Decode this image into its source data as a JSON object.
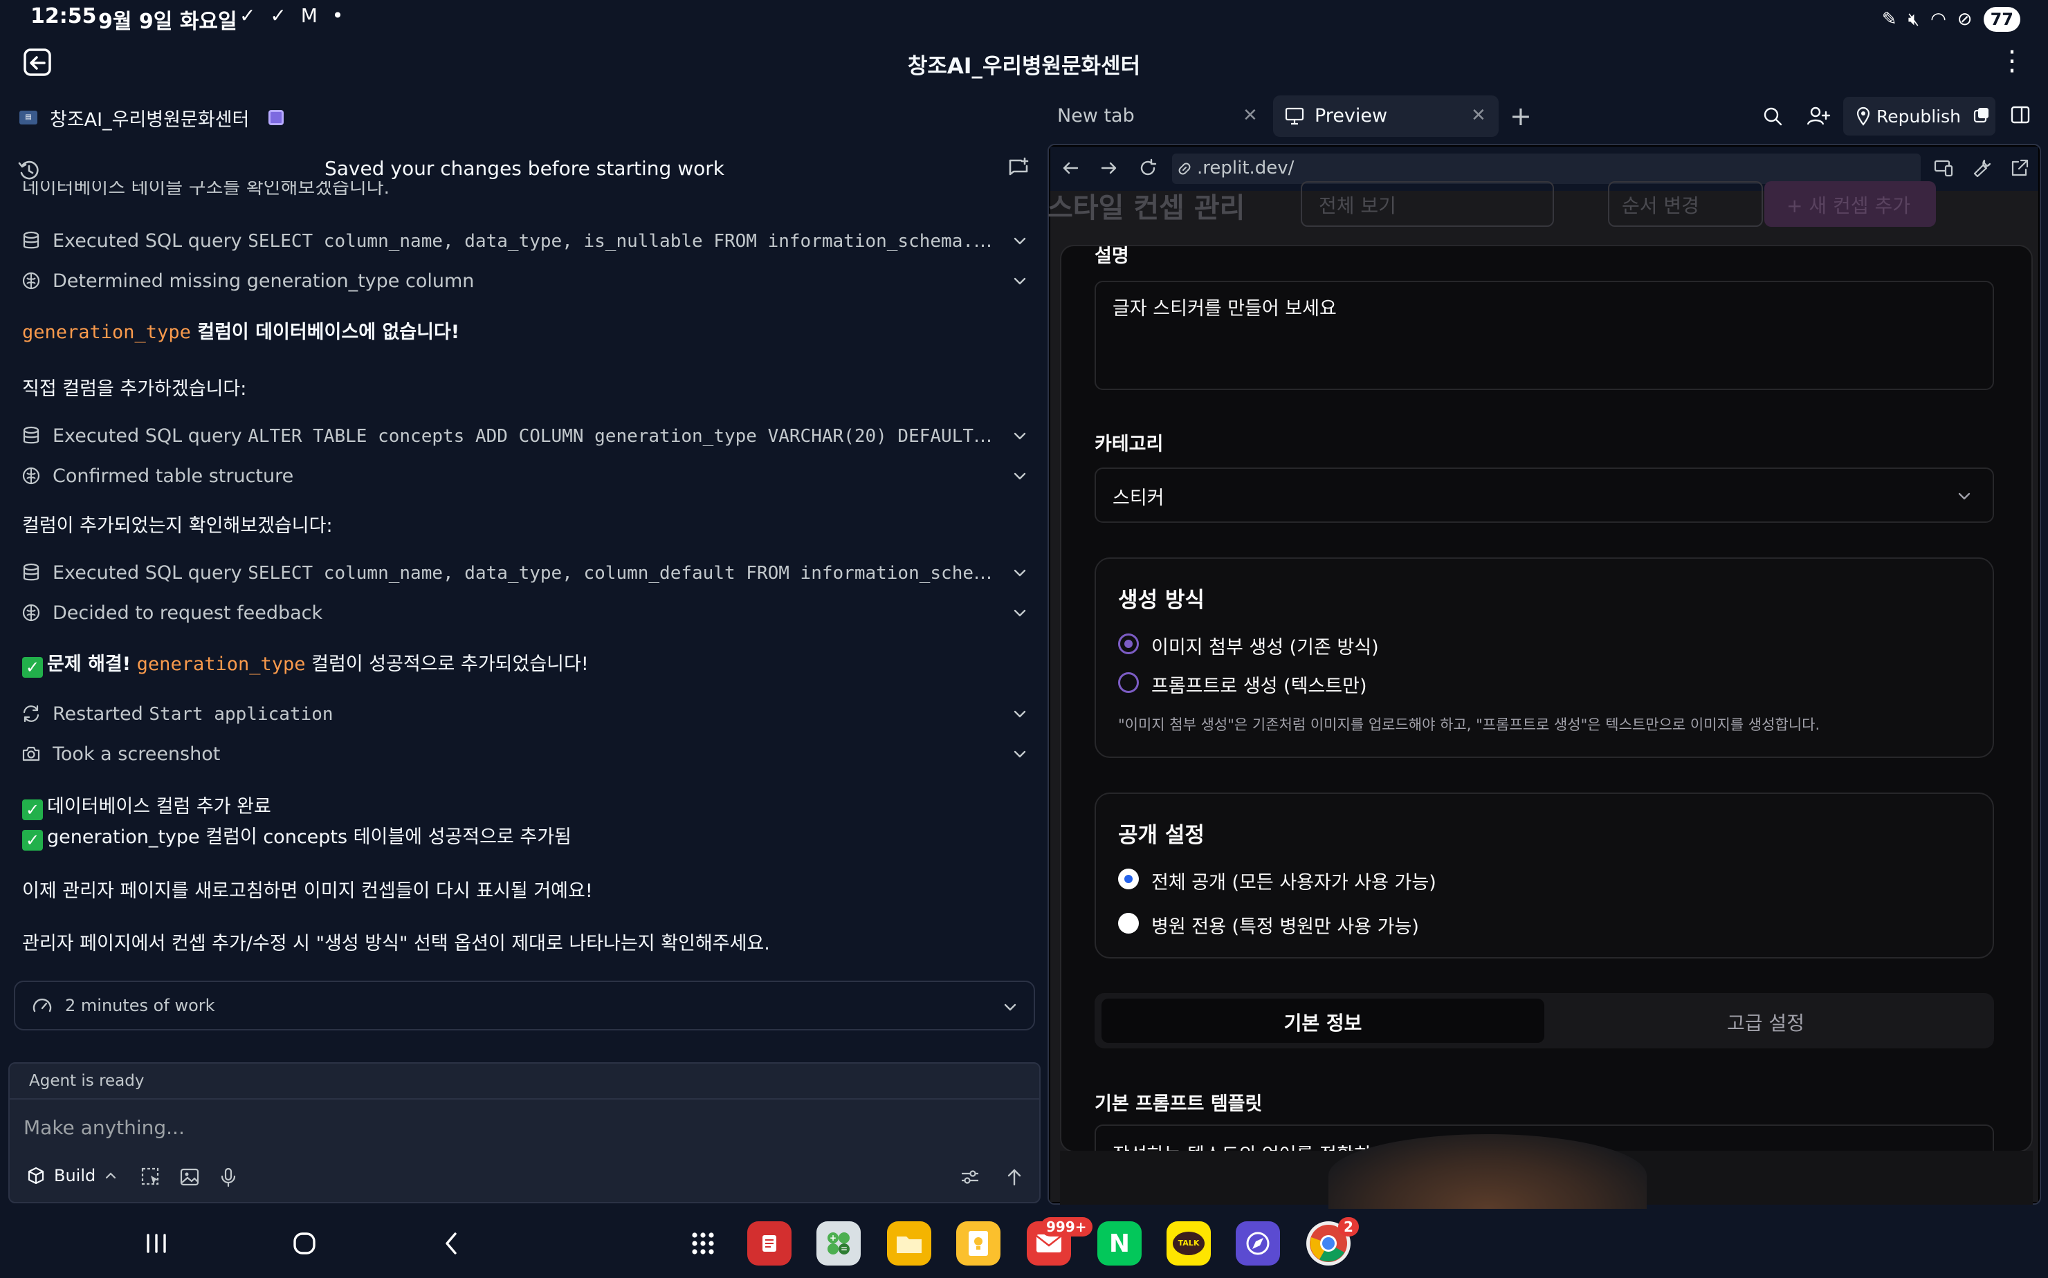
{
  "status_bar": {
    "time": "12:55",
    "date": "9월 9일 화요일",
    "notif_icons": "✓ ✓ M •",
    "battery": "77"
  },
  "app": {
    "title": "창조AI_우리병원문화센터"
  },
  "left": {
    "project_name": "창조AI_우리병원문화센터",
    "saved_message": "Saved your changes before starting work",
    "clipped_text": "데이터베이스 테이블 구조를 확인해보겠습니다.",
    "activities": [
      {
        "text": "Executed SQL query ",
        "code": "SELECT column_name, data_type, is_nullable FROM information_schema.co..."
      },
      {
        "text": "Determined missing generation_type column",
        "code": ""
      },
      {
        "text": "Executed SQL query ",
        "code": "ALTER TABLE concepts ADD COLUMN generation_type VARCHAR(20) DEFAULT '..."
      },
      {
        "text": "Confirmed table structure",
        "code": ""
      },
      {
        "text": "Executed SQL query ",
        "code": "SELECT column_name, data_type, column_default FROM information_schema..."
      },
      {
        "text": "Decided to request feedback",
        "code": ""
      },
      {
        "text": "Restarted ",
        "code": "Start application"
      },
      {
        "text": "Took a screenshot",
        "code": ""
      }
    ],
    "messages": {
      "missing_code": "generation_type",
      "missing_text": " 컬럼이 데이터베이스에 없습니다!",
      "add_direct": "직접 컬럼을 추가하겠습니다:",
      "verify": "컬럼이 추가되었는지 확인해보겠습니다:",
      "solved_bold": "문제 해결!",
      "solved_code": "generation_type",
      "solved_text": " 컬럼이 성공적으로 추가되었습니다!",
      "done1": "데이터베이스 컬럼 추가 완료",
      "done2": "generation_type 컬럼이 concepts 테이블에 성공적으로 추가됨",
      "refresh": "이제 관리자 페이지를 새로고침하면 이미지 컨셉들이 다시 표시될 거예요!",
      "check": "관리자 페이지에서 컨셉 추가/수정 시 \"생성 방식\" 선택 옵션이 제대로 나타나는지 확인해주세요."
    },
    "work_summary": "2 minutes of work",
    "agent_status": "Agent is ready",
    "prompt_placeholder": "Make anything...",
    "build_label": "Build"
  },
  "right": {
    "tabs": [
      {
        "label": "New tab"
      },
      {
        "label": "Preview"
      }
    ],
    "republish_label": "Republish",
    "url": ".replit.dev/",
    "preview": {
      "bg_title": "스타일 컨셉 관리",
      "bg_filter": "전체 보기",
      "bg_order": "순서 변경",
      "bg_add": "+ 새 컨셉 추가",
      "desc_label": "설명",
      "desc_value": "글자 스티커를 만들어 보세요",
      "category_label": "카테고리",
      "category_value": "스티커",
      "gen_title": "생성 방식",
      "gen_options": [
        {
          "label": "이미지 첨부 생성 (기존 방식)",
          "selected": true
        },
        {
          "label": "프롬프트로 생성 (텍스트만)",
          "selected": false
        }
      ],
      "gen_note": "\"이미지 첨부 생성\"은 기존처럼 이미지를 업로드해야 하고, \"프롬프트로 생성\"은 텍스트만으로 이미지를 생성합니다.",
      "pub_title": "공개 설정",
      "pub_options": [
        {
          "label": "전체 공개 (모든 사용자가 사용 가능)",
          "selected": true
        },
        {
          "label": "병원 전용 (특정 병원만 사용 가능)",
          "selected": false
        }
      ],
      "seg_tabs": [
        {
          "label": "기본 정보",
          "active": true
        },
        {
          "label": "고급 설정",
          "active": false
        }
      ],
      "template_label": "기본 프롬프트 템플릿",
      "template_value": "작성하는 텍스트의 언어를 정확히 표현해지"
    }
  },
  "dock": {
    "notif_count_mail": "999+",
    "notif_count_chrome": "2",
    "kakao_label": "TALK",
    "naver_label": "N"
  },
  "colors": {
    "bg": "#0e1525",
    "surface": "#1c2333",
    "accent_code": "#f99a4c",
    "check_green": "#22b04b",
    "radio_purple": "#7c5cc4",
    "radio_blue": "#2563eb"
  }
}
